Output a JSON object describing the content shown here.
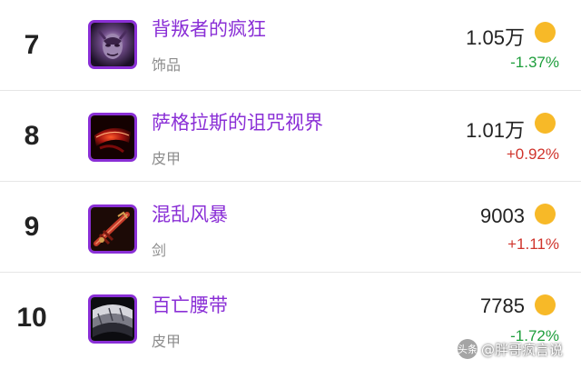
{
  "items": [
    {
      "rank": "7",
      "name": "背叛者的疯狂",
      "category": "饰品",
      "price": "1.05万",
      "change": "-1.37%",
      "direction": "down",
      "icon": "betrayer-madness-icon"
    },
    {
      "rank": "8",
      "name": "萨格拉斯的诅咒视界",
      "category": "皮甲",
      "price": "1.01万",
      "change": "+0.92%",
      "direction": "up",
      "icon": "sargeras-cursed-vision-icon"
    },
    {
      "rank": "9",
      "name": "混乱风暴",
      "category": "剑",
      "price": "9003",
      "change": "+1.11%",
      "direction": "up",
      "icon": "chaos-storm-icon"
    },
    {
      "rank": "10",
      "name": "百亡腰带",
      "category": "皮甲",
      "price": "7785",
      "change": "-1.72%",
      "direction": "down",
      "icon": "hundred-deaths-belt-icon"
    }
  ],
  "watermark": {
    "logo": "头条",
    "text": "@胖哥疯言说"
  },
  "colors": {
    "name": "#8a2fd6",
    "down": "#1e9e3c",
    "up": "#d0342c",
    "coin": "#f7b928"
  }
}
